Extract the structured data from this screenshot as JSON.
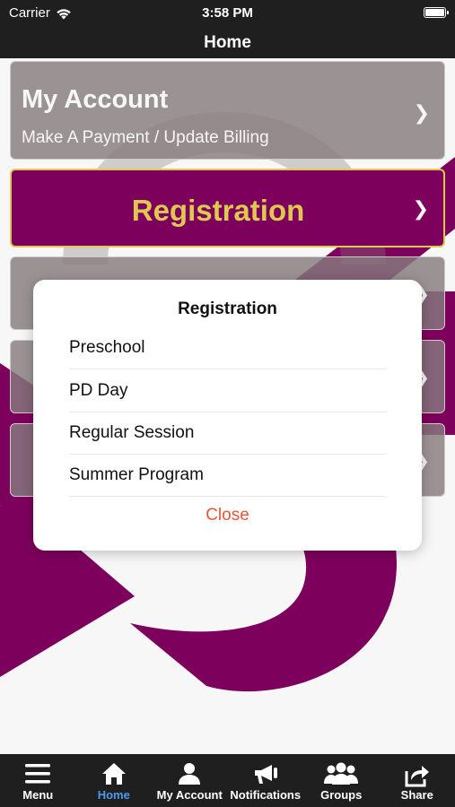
{
  "status_bar": {
    "carrier": "Carrier",
    "time": "3:58 PM"
  },
  "nav_bar": {
    "title": "Home"
  },
  "tiles": {
    "my_account": {
      "title": "My Account",
      "subtitle": "Make A Payment / Update Billing",
      "chevron": "❯"
    },
    "registration": {
      "title": "Registration",
      "chevron": "❯"
    },
    "tile3": {
      "chevron": "❯"
    },
    "tile4": {
      "chevron": "❯"
    },
    "tile5": {
      "chevron": "❯"
    }
  },
  "dialog": {
    "title": "Registration",
    "options": [
      "Preschool",
      "PD Day",
      "Regular Session",
      "Summer Program"
    ],
    "close_label": "Close"
  },
  "tab_bar": {
    "tabs": [
      {
        "label": "Menu",
        "icon": "menu-icon"
      },
      {
        "label": "Home",
        "icon": "home-icon",
        "active": true
      },
      {
        "label": "My Account",
        "icon": "person-icon"
      },
      {
        "label": "Notifications",
        "icon": "megaphone-icon"
      },
      {
        "label": "Groups",
        "icon": "groups-icon"
      },
      {
        "label": "Share",
        "icon": "share-icon"
      }
    ]
  },
  "colors": {
    "brand_purple": "#82005f",
    "accent_gold": "#e7cf55",
    "tile_gray": "#8c8083",
    "close_red": "#e8553a",
    "active_tab_blue": "#4a9bf0",
    "bar_dark": "#1f1f1f"
  }
}
